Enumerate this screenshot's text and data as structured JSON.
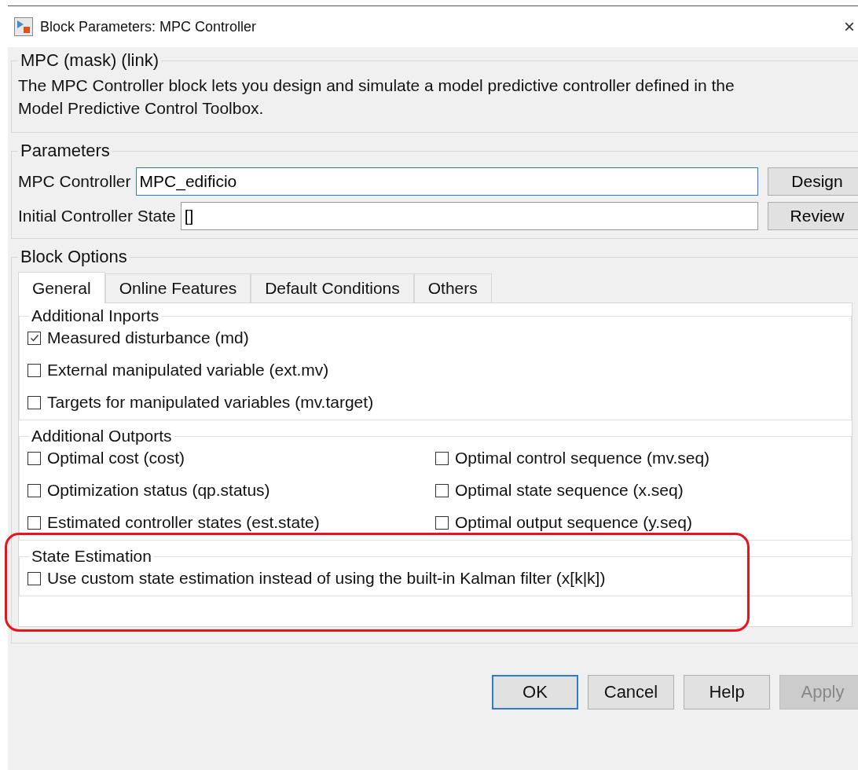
{
  "window": {
    "title": "Block Parameters: MPC Controller",
    "close": "×"
  },
  "mask": {
    "title": "MPC (mask) (link)",
    "description": "The MPC Controller block lets you design and simulate a model predictive controller defined in the Model Predictive Control Toolbox."
  },
  "parameters": {
    "title": "Parameters",
    "fields": [
      {
        "label": "MPC Controller",
        "value": "MPC_edificio",
        "focused": true,
        "button": "Design"
      },
      {
        "label": "Initial Controller State",
        "value": "[]",
        "focused": false,
        "button": "Review"
      }
    ]
  },
  "block_options": {
    "title": "Block Options",
    "tabs": [
      {
        "label": "General",
        "selected": true
      },
      {
        "label": "Online Features",
        "selected": false
      },
      {
        "label": "Default Conditions",
        "selected": false
      },
      {
        "label": "Others",
        "selected": false
      }
    ],
    "groups": [
      {
        "title": "Additional Inports",
        "kind": "list",
        "highlighted": false,
        "options": [
          {
            "label": "Measured disturbance (md)",
            "checked": true
          },
          {
            "label": "External manipulated variable (ext.mv)",
            "checked": false
          },
          {
            "label": "Targets for manipulated variables (mv.target)",
            "checked": false
          }
        ]
      },
      {
        "title": "Additional Outports",
        "kind": "grid",
        "highlighted": false,
        "options": [
          {
            "label": "Optimal cost (cost)",
            "checked": false
          },
          {
            "label": "Optimal control sequence (mv.seq)",
            "checked": false
          },
          {
            "label": "Optimization status (qp.status)",
            "checked": false
          },
          {
            "label": "Optimal state sequence (x.seq)",
            "checked": false
          },
          {
            "label": "Estimated controller states (est.state)",
            "checked": false
          },
          {
            "label": "Optimal output sequence (y.seq)",
            "checked": false
          }
        ]
      },
      {
        "title": "State Estimation",
        "kind": "list",
        "highlighted": true,
        "options": [
          {
            "label": "Use custom state estimation instead of using the built-in Kalman filter (x[k|k])",
            "checked": false
          }
        ]
      }
    ]
  },
  "buttons": [
    {
      "label": "OK",
      "default": true,
      "disabled": false
    },
    {
      "label": "Cancel",
      "default": false,
      "disabled": false
    },
    {
      "label": "Help",
      "default": false,
      "disabled": false
    },
    {
      "label": "Apply",
      "default": false,
      "disabled": true
    }
  ]
}
